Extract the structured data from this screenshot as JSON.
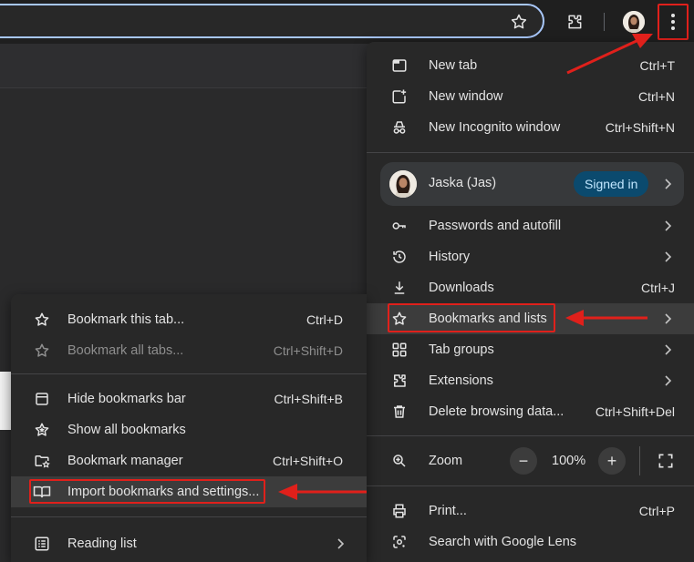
{
  "main_menu": {
    "items_top": [
      {
        "label": "New tab",
        "shortcut": "Ctrl+T",
        "icon": "new-tab-icon"
      },
      {
        "label": "New window",
        "shortcut": "Ctrl+N",
        "icon": "new-window-icon"
      },
      {
        "label": "New Incognito window",
        "shortcut": "Ctrl+Shift+N",
        "icon": "incognito-icon"
      }
    ],
    "profile": {
      "name": "Jaska (Jas)",
      "status": "Signed in"
    },
    "items_mid": [
      {
        "label": "Passwords and autofill",
        "icon": "key-icon"
      },
      {
        "label": "History",
        "icon": "history-icon"
      },
      {
        "label": "Downloads",
        "shortcut": "Ctrl+J",
        "icon": "download-icon"
      },
      {
        "label": "Bookmarks and lists",
        "icon": "star-icon"
      },
      {
        "label": "Tab groups",
        "icon": "tab-groups-icon"
      },
      {
        "label": "Extensions",
        "icon": "puzzle-icon"
      },
      {
        "label": "Delete browsing data...",
        "shortcut": "Ctrl+Shift+Del",
        "icon": "trash-icon"
      }
    ],
    "zoom": {
      "label": "Zoom",
      "value": "100%",
      "minus": "−",
      "plus": "+"
    },
    "items_bottom": [
      {
        "label": "Print...",
        "shortcut": "Ctrl+P",
        "icon": "print-icon"
      },
      {
        "label": "Search with Google Lens",
        "icon": "lens-icon"
      }
    ]
  },
  "sub_menu": {
    "items": [
      {
        "label": "Bookmark this tab...",
        "shortcut": "Ctrl+D",
        "icon": "star-icon"
      },
      {
        "label": "Bookmark all tabs...",
        "shortcut": "Ctrl+Shift+D",
        "icon": "star-all-icon",
        "disabled": true
      },
      {
        "label": "Hide bookmarks bar",
        "shortcut": "Ctrl+Shift+B",
        "icon": "bookmarks-bar-icon"
      },
      {
        "label": "Show all bookmarks",
        "icon": "stars-icon"
      },
      {
        "label": "Bookmark manager",
        "shortcut": "Ctrl+Shift+O",
        "icon": "folder-star-icon"
      },
      {
        "label": "Import bookmarks and settings...",
        "icon": "import-icon"
      },
      {
        "label": "Reading list",
        "icon": "reading-list-icon"
      }
    ]
  },
  "colors": {
    "accent_red": "#e0201b",
    "signed_in_pill": "#0b4a6e",
    "menu_bg": "#282828"
  }
}
